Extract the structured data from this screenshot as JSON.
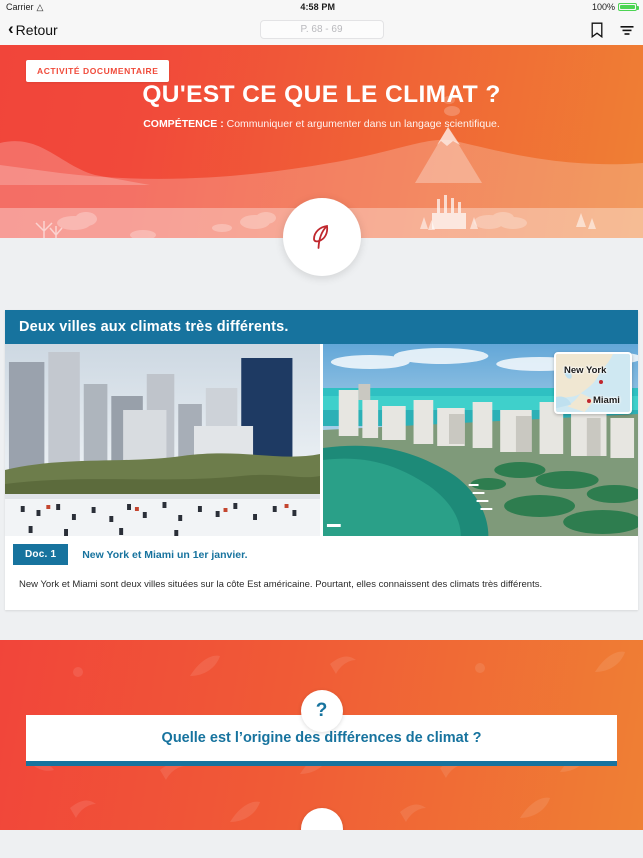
{
  "status_bar": {
    "carrier": "Carrier",
    "wifi_icon": "wifi-icon",
    "time": "4:58 PM",
    "battery_percent": "100%"
  },
  "nav_bar": {
    "back_label": "Retour",
    "back_icon": "chevron-left-icon",
    "page_indicator": "P. 68 - 69",
    "bookmark_icon": "bookmark-icon",
    "menu_icon": "list-menu-icon"
  },
  "hero": {
    "badge": "ACTIVITÉ DOCUMENTAIRE",
    "title": "QU'EST CE QUE LE CLIMAT ?",
    "competence_label": "COMPÉTENCE :",
    "competence_text": " Communiquer et argumenter dans un langage scientifique.",
    "logo_icon": "leaf-logo-icon",
    "gradient_start": "#F1453A",
    "gradient_end": "#EF8034"
  },
  "document_card": {
    "header": "Deux villes aux climats très différents.",
    "header_color": "#17739E",
    "left_photo_alt": "new-york-ice-rink-photo",
    "right_photo_alt": "miami-coastline-photo",
    "map": {
      "label_north": "New York",
      "label_south": "Miami",
      "dot_color": "#C0272D"
    },
    "doc_badge": "Doc. 1",
    "doc_title": "New York et Miami un 1er janvier.",
    "doc_text": "New York et Miami sont deux villes situées sur la côte Est américaine. Pourtant, elles connaissent des climats très différents."
  },
  "question_band": {
    "bubble_symbol": "?",
    "question": "Quelle est l’origine des différences de climat ?",
    "accent_color": "#17739E"
  }
}
